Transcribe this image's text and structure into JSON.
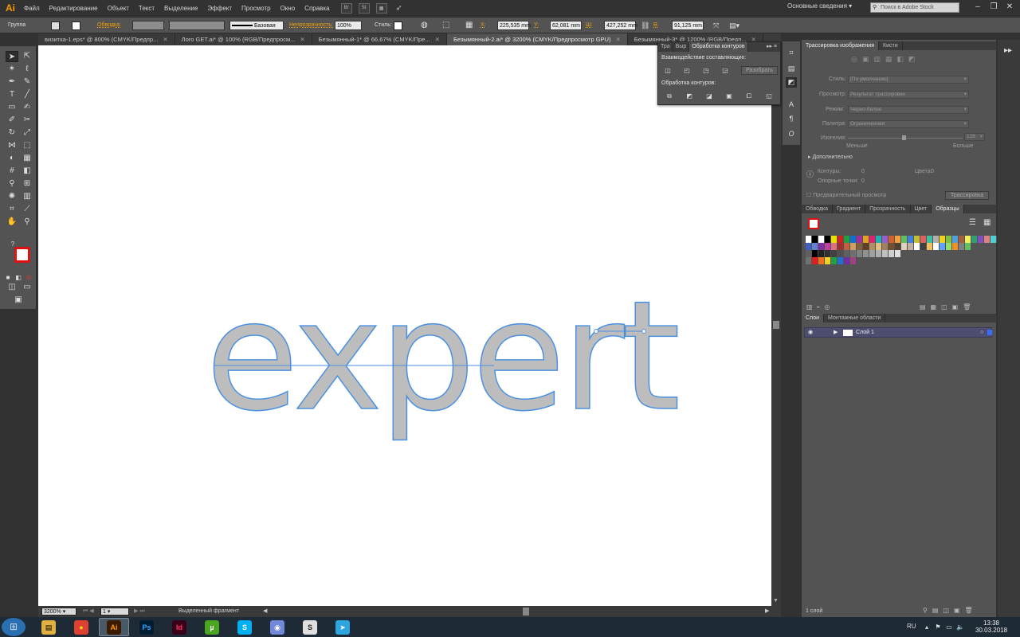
{
  "app": {
    "logo": "Ai"
  },
  "menubar": {
    "items": [
      "Файл",
      "Редактирование",
      "Объект",
      "Текст",
      "Выделение",
      "Эффект",
      "Просмотр",
      "Окно",
      "Справка"
    ],
    "bridge_icon": "Br",
    "stock_icon": "St",
    "workspace": "Основные сведения",
    "search_placeholder": "Поиск в Adobe Stock"
  },
  "controlbar": {
    "selection_type": "Группа",
    "stroke_label": "Обводка:",
    "brush_label": "Базовая",
    "opacity_label": "Непрозрачность:",
    "opacity_value": "100%",
    "style_label": "Стиль:",
    "x_label": "X:",
    "x_value": "225,535 mm",
    "y_label": "Y:",
    "y_value": "62,081 mm",
    "w_label": "Ш:",
    "w_value": "427,252 mm",
    "h_label": "В:",
    "h_value": "91,125 mm"
  },
  "doctabs": [
    {
      "label": "визитка-1.eps* @ 800% (CMYK/Предпр...",
      "active": false
    },
    {
      "label": "Лого GET.ai* @ 100% (RGB/Предпросм...",
      "active": false
    },
    {
      "label": "Безымянный-1* @ 66,67% (CMYK/Пре...",
      "active": false
    },
    {
      "label": "Безымянный-2.ai* @ 3200% (CMYK/Предпросмотр GPU)",
      "active": true
    },
    {
      "label": "Безымянный-3* @ 1200% (RGB/Предп...",
      "active": false
    }
  ],
  "canvas": {
    "artwork_text": "expert",
    "fill_color": "#bdbdbd",
    "outline_color": "#4a90e2"
  },
  "pathfinder": {
    "tabs": [
      "Тра",
      "Выр",
      "Обработка контуров"
    ],
    "shape_modes_label": "Взаимодействие составляющих:",
    "expand_button": "Разобрать",
    "pathfinders_label": "Обработка контуров:"
  },
  "image_trace": {
    "tabs": [
      "Трассировка изображения",
      "Кисти"
    ],
    "preset_label": "Стиль:",
    "preset_value": "[По умолчанию]",
    "view_label": "Просмотр:",
    "view_value": "Результат трассировки",
    "mode_label": "Режим:",
    "mode_value": "Черно-белое",
    "palette_label": "Палитра:",
    "palette_value": "Ограниченная",
    "threshold_label": "Изогелия:",
    "threshold_value": "128",
    "less_label": "Меньше",
    "more_label": "Больше",
    "advanced_label": "Дополнительно",
    "paths_label": "Контуры:",
    "paths_value": "0",
    "colors_label": "Цвета:",
    "colors_value": "0",
    "anchors_label": "Опорные точки:",
    "anchors_value": "0",
    "preview_label": "Предварительный просмотр",
    "trace_button": "Трассировка"
  },
  "swatches_panel": {
    "tabs": [
      "Обводка",
      "Градиент",
      "Прозрачность",
      "Цвет",
      "Образцы"
    ],
    "rows": [
      [
        "#ffffff",
        "#000000",
        "#ffffff",
        "#000000",
        "#e8e000",
        "#d02020",
        "#20a040",
        "#1070d0",
        "#a030a0",
        "#e0a020",
        "#e02070",
        "#20b0b0",
        "#9060d0",
        "#d06030",
        "#f0a040",
        "#60c060",
        "#4080e0",
        "#c0c030",
        "#e06060",
        "#40c0a0",
        "#b0b0b0",
        "#f0d020",
        "#80c040",
        "#50a0e0",
        "#a06040",
        "#f0f060",
        "#30a070",
        "#8050c0",
        "#e08080",
        "#50d0d0"
      ],
      [
        "#4060c0",
        "#6080d0",
        "#8030a0",
        "#c040a0",
        "#e07080",
        "#a03030",
        "#c06040",
        "#d0a060",
        "#806040",
        "#604020",
        "#b09060",
        "#e0c080",
        "#a08060",
        "#705030",
        "#504030",
        "#e0d0c0",
        "#c0b0a0",
        "#ffffff",
        "#404040",
        "#f0c060",
        "#ffffff",
        "#60a0ff",
        "#90e070",
        "#f09020",
        "#808080",
        "#60c060"
      ],
      [
        "#606060",
        "#000000",
        "#202020",
        "#303030",
        "#404040",
        "#505050",
        "#606060",
        "#707070",
        "#808080",
        "#909090",
        "#a0a0a0",
        "#b0b0b0",
        "#c0c0c0",
        "#d0d0d0",
        "#e0e0e0"
      ],
      [
        "#707070",
        "#e02020",
        "#f07020",
        "#f0d020",
        "#20a040",
        "#2070d0",
        "#7030a0",
        "#a04080"
      ]
    ]
  },
  "layers_panel": {
    "tabs": [
      "Слои",
      "Монтажные области"
    ],
    "layer_name": "Слой 1",
    "footer": "1 слой"
  },
  "statusbar": {
    "zoom": "3200%",
    "artboard": "1",
    "status_text": "Выделенный фрагмент"
  },
  "taskbar": {
    "apps": [
      {
        "name": "Explorer",
        "label": "▤",
        "color": "#e0b040",
        "fg": "#000000"
      },
      {
        "name": "Chrome",
        "label": "●",
        "color": "#e04030",
        "fg": "#f0d020"
      },
      {
        "name": "Illustrator",
        "label": "Ai",
        "color": "#3a1a00",
        "fg": "#ff9a00",
        "active": true
      },
      {
        "name": "Photoshop",
        "label": "Ps",
        "color": "#001d34",
        "fg": "#31a8ff"
      },
      {
        "name": "InDesign",
        "label": "Id",
        "color": "#3a0018",
        "fg": "#ff3366"
      },
      {
        "name": "uTorrent",
        "label": "µ",
        "color": "#4aa520",
        "fg": "#ffffff"
      },
      {
        "name": "Skype",
        "label": "S",
        "color": "#00aff0",
        "fg": "#ffffff"
      },
      {
        "name": "Discord",
        "label": "◉",
        "color": "#7289da",
        "fg": "#ffffff"
      },
      {
        "name": "Stock",
        "label": "S",
        "color": "#e0e0e0",
        "fg": "#222222"
      },
      {
        "name": "Telegram",
        "label": "➤",
        "color": "#2ca5e0",
        "fg": "#ffffff"
      }
    ],
    "language": "RU",
    "time": "13:38",
    "date": "30.03.2018"
  }
}
